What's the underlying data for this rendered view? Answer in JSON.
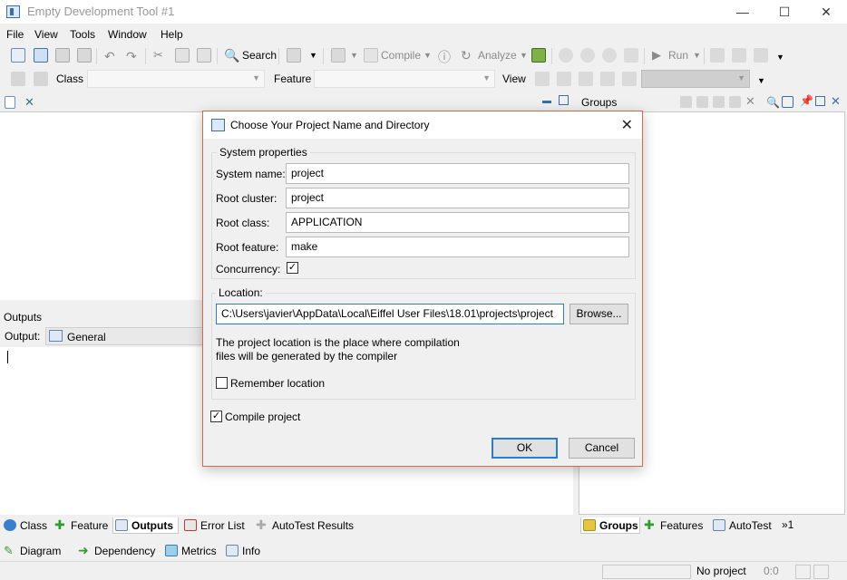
{
  "window": {
    "title": "Empty Development Tool #1",
    "controls": {
      "minimize": "—",
      "maximize": "☐",
      "close": "✕"
    }
  },
  "menubar": {
    "items": [
      "File",
      "View",
      "Tools",
      "Window",
      "Help"
    ]
  },
  "toolbar1": {
    "search_label": "Search",
    "compile_label": "Compile",
    "analyze_label": "Analyze",
    "run_label": "Run"
  },
  "toolbar2": {
    "class_label": "Class",
    "class_value": "",
    "feature_label": "Feature",
    "feature_value": "",
    "view_label": "View",
    "view_value": ""
  },
  "groups_panel": {
    "title": "Groups"
  },
  "outputs_panel": {
    "title": "Outputs",
    "output_label": "Output:",
    "output_select": "General"
  },
  "bottom_tabs_left": {
    "tabs": [
      "Class",
      "Feature",
      "Outputs",
      "Error List",
      "AutoTest Results"
    ],
    "active": "Outputs"
  },
  "bottom_tabs_right": {
    "tabs": [
      "Groups",
      "Features",
      "AutoTest"
    ],
    "overflow": "»1",
    "active": "Groups"
  },
  "bottom_tabs_row2": {
    "tabs": [
      "Diagram",
      "Dependency",
      "Metrics",
      "Info"
    ]
  },
  "statusbar": {
    "project": "No project",
    "position": "0:0"
  },
  "dialog": {
    "title": "Choose Your Project Name and Directory",
    "system_group": "System properties",
    "system_name_label": "System name:",
    "system_name_value": "project",
    "root_cluster_label": "Root cluster:",
    "root_cluster_value": "project",
    "root_class_label": "Root class:",
    "root_class_value": "APPLICATION",
    "root_feature_label": "Root feature:",
    "root_feature_value": "make",
    "concurrency_label": "Concurrency:",
    "concurrency_checked": true,
    "location_group": "Location:",
    "location_value": "C:\\Users\\javier\\AppData\\Local\\Eiffel User Files\\18.01\\projects\\project",
    "browse_label": "Browse...",
    "note_line1": "The project location is the place where compilation",
    "note_line2": "files will be generated by the compiler",
    "remember_label": "Remember location",
    "remember_checked": false,
    "compile_label": "Compile project",
    "compile_checked": true,
    "ok_label": "OK",
    "cancel_label": "Cancel"
  },
  "colors": {
    "dialog_border": "#d06a4f",
    "focus_blue": "#2a7bd4"
  }
}
